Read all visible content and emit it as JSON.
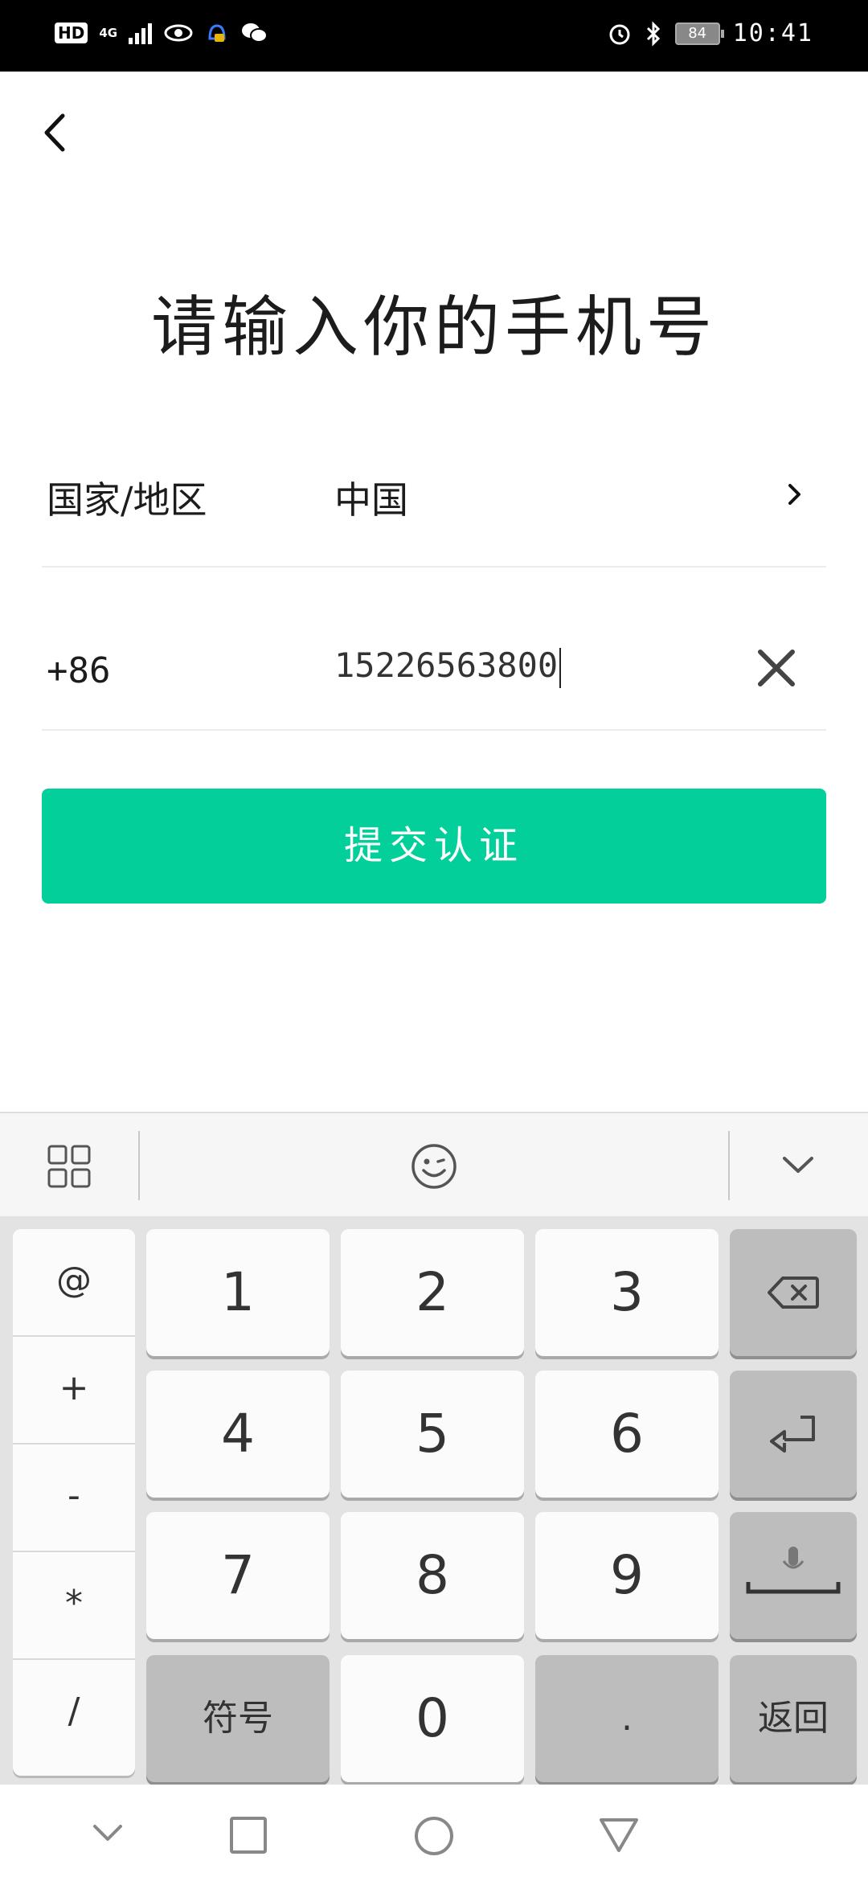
{
  "status_bar": {
    "left_badge": "HD",
    "network": "4G",
    "battery": "84",
    "time": "10:41"
  },
  "page": {
    "title": "请输入你的手机号"
  },
  "form": {
    "region_label": "国家/地区",
    "region_value": "中国",
    "country_code": "+86",
    "phone_value": "15226563800",
    "submit_label": "提交认证"
  },
  "keyboard": {
    "symbols": [
      "@",
      "+",
      "-",
      "*",
      "/"
    ],
    "keys": {
      "k1": "1",
      "k2": "2",
      "k3": "3",
      "k4": "4",
      "k5": "5",
      "k6": "6",
      "k7": "7",
      "k8": "8",
      "k9": "9",
      "k0": "0",
      "symbol_key": "符号",
      "dot": ".",
      "return_key": "返回"
    }
  },
  "colors": {
    "accent": "#03cf9a",
    "status_bar": "#000000",
    "keyboard_bg": "#e3e3e3"
  },
  "icons": [
    "back-arrow-icon",
    "chevron-right-icon",
    "clear-icon",
    "grid-icon",
    "emoji-icon",
    "collapse-keyboard-icon",
    "backspace-icon",
    "enter-icon",
    "microphone-icon",
    "nav-back-icon",
    "nav-recents-icon",
    "nav-home-icon",
    "nav-triangle-icon"
  ]
}
